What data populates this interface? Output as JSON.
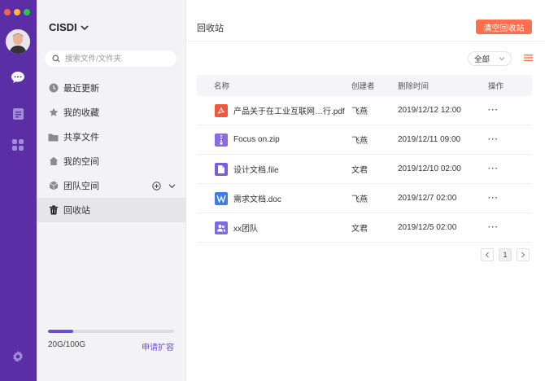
{
  "org_name": "CISDI",
  "search": {
    "placeholder": "搜索文件/文件夹"
  },
  "nav": [
    {
      "label": "最近更新",
      "icon": "clock-icon"
    },
    {
      "label": "我的收藏",
      "icon": "star-icon"
    },
    {
      "label": "共享文件",
      "icon": "folder-icon"
    },
    {
      "label": "我的空间",
      "icon": "home-icon"
    },
    {
      "label": "团队空间",
      "icon": "cube-icon"
    },
    {
      "label": "回收站",
      "icon": "trash-icon"
    }
  ],
  "active_nav": "回收站",
  "storage": {
    "used_label": "20G/100G",
    "fraction": 0.2,
    "expand_label": "申请扩容"
  },
  "page_title": "回收站",
  "clear_button": "清空回收站",
  "filter": {
    "selected": "全部"
  },
  "table": {
    "headers": {
      "name": "名称",
      "creator": "创建者",
      "time": "删除时间",
      "op": "操作"
    },
    "rows": [
      {
        "name": "产品关于在工业互联网…行.pdf",
        "type": "pdf",
        "creator": "飞燕",
        "time": "2019/12/12  12:00",
        "op": "···"
      },
      {
        "name": "Focus on.zip",
        "type": "zip",
        "creator": "飞燕",
        "time": "2019/12/11   09:00",
        "op": "···"
      },
      {
        "name": "设计文档.file",
        "type": "file",
        "creator": "文君",
        "time": "2019/12/10   02:00",
        "op": "···"
      },
      {
        "name": "需求文档.doc",
        "type": "doc",
        "creator": "飞燕",
        "time": "2019/12/7    02:00",
        "op": "···"
      },
      {
        "name": "xx团队",
        "type": "team",
        "creator": "文君",
        "time": "2019/12/5    02:00",
        "op": "···"
      }
    ]
  },
  "pagination": {
    "current": "1"
  },
  "colors": {
    "rail": "#5b2ea6",
    "accent": "#6a4fd0",
    "danger_button": "#ff6f4e",
    "pdf": "#f0593e",
    "zip": "#8b6ce0",
    "file": "#7b5ce0",
    "doc": "#3f7ce6",
    "team": "#7b6ce0"
  }
}
